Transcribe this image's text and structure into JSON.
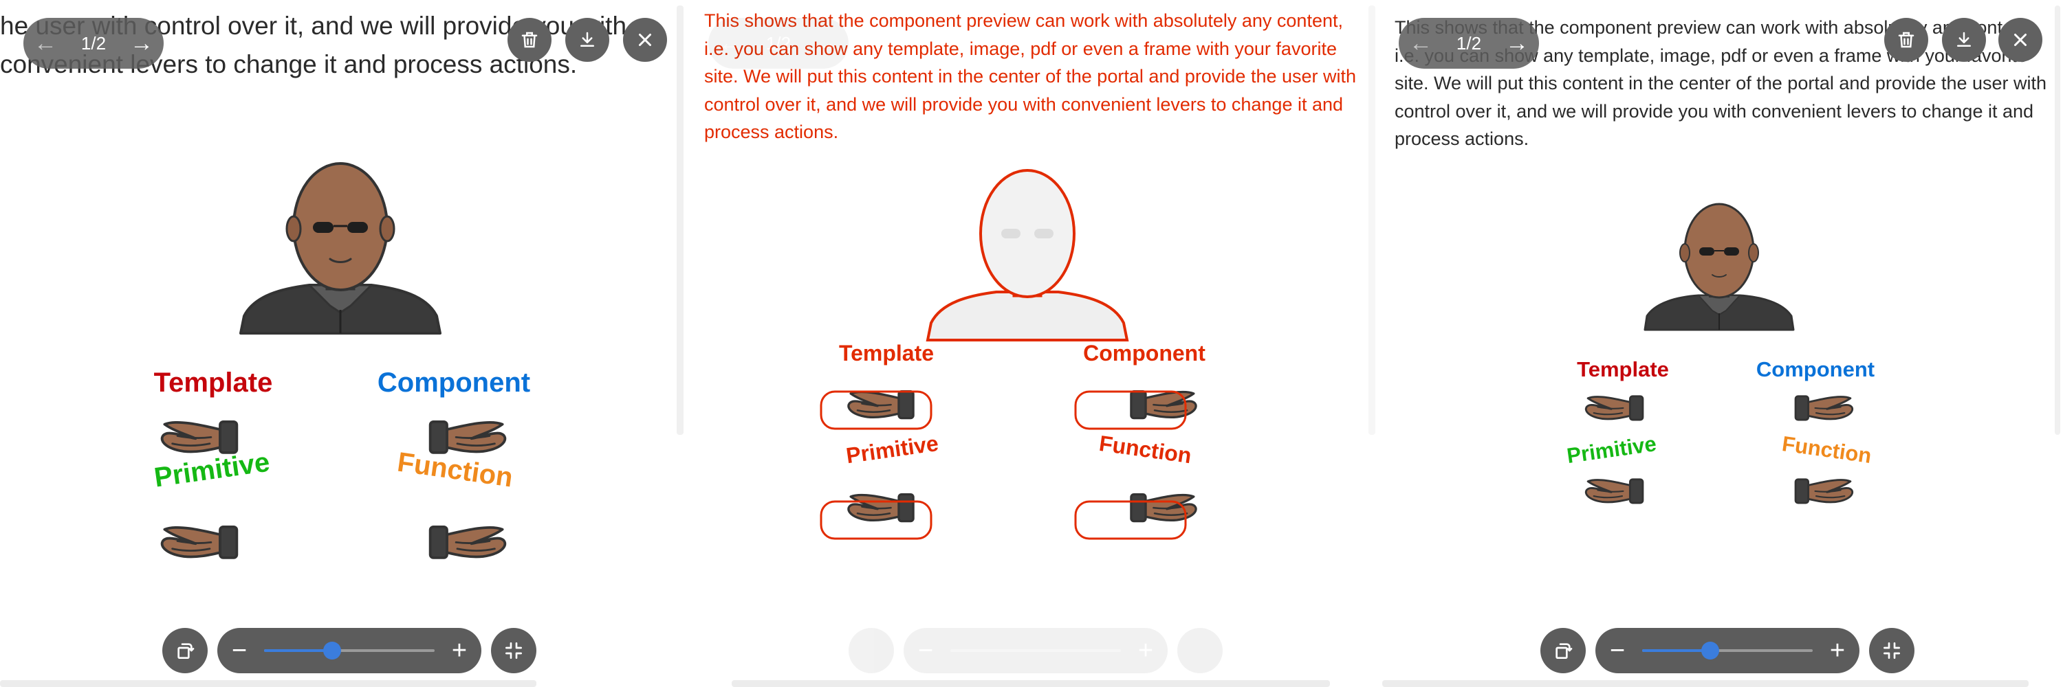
{
  "preview": {
    "description": "This shows that the component preview can work with absolutely any content, i.e. you can show any template, image, pdf or even a frame with your favorite site. We will put this content in the center of the portal and provide the user with control over it, and we will provide you with convenient levers to change it and process actions.",
    "description_tail": "he user with control over it, and we will provide you with convenient levers to change it and process actions.",
    "page_counter": "1/2",
    "zoom_level": 0.4
  },
  "figure": {
    "labels": {
      "template": "Template",
      "component": "Component",
      "primitive": "Primitive",
      "function": "Function"
    }
  },
  "colors": {
    "template": "#c5050c",
    "component": "#0a72d8",
    "primitive": "#15b814",
    "function": "#f08a1d",
    "toolbar": "#5c5c5c",
    "accent": "#3b7ddd",
    "highlight": "#e22b00"
  },
  "icons": {
    "prev": "arrow-left-icon",
    "next": "arrow-right-icon",
    "delete": "trash-icon",
    "download": "download-icon",
    "close": "close-icon",
    "rotate": "rotate-icon",
    "zoom_out": "minus-icon",
    "zoom_in": "plus-icon",
    "fullscreen": "collapse-icon"
  }
}
